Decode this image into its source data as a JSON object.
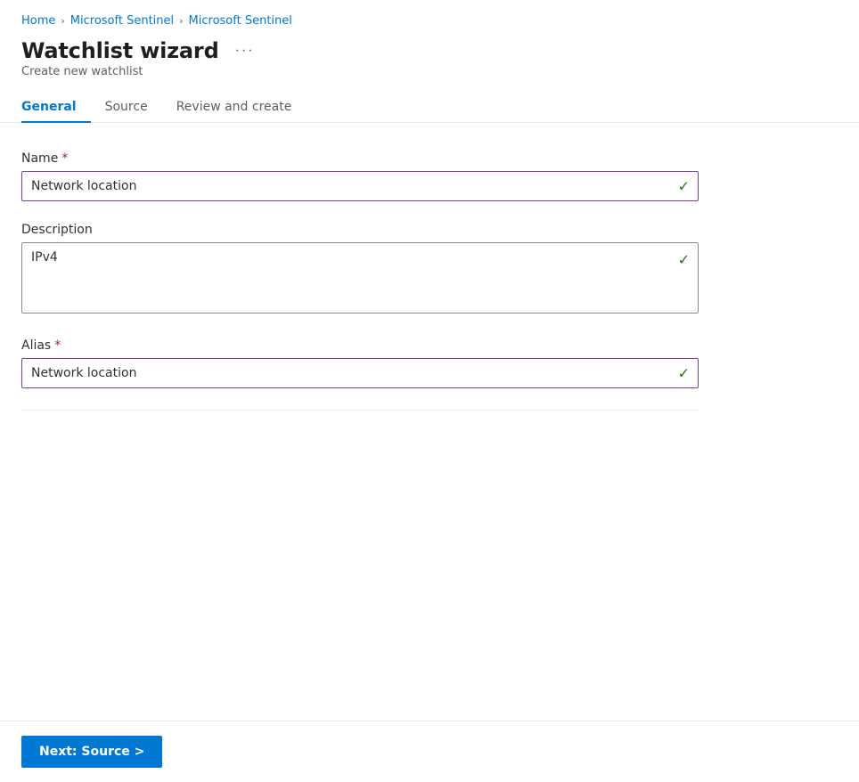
{
  "breadcrumb": {
    "items": [
      {
        "label": "Home",
        "href": "#"
      },
      {
        "label": "Microsoft Sentinel",
        "href": "#"
      },
      {
        "label": "Microsoft Sentinel",
        "href": "#"
      }
    ],
    "separator": "›"
  },
  "header": {
    "title": "Watchlist wizard",
    "more_options_label": "···",
    "subtitle": "Create new watchlist"
  },
  "tabs": [
    {
      "id": "general",
      "label": "General",
      "active": true
    },
    {
      "id": "source",
      "label": "Source",
      "active": false
    },
    {
      "id": "review_create",
      "label": "Review and create",
      "active": false
    }
  ],
  "form": {
    "name_label": "Name",
    "name_required": true,
    "name_value": "Network location",
    "name_check": "✓",
    "description_label": "Description",
    "description_value": "IPv4",
    "description_check": "✓",
    "alias_label": "Alias",
    "alias_required": true,
    "alias_value": "Network location",
    "alias_check": "✓"
  },
  "footer": {
    "next_button_label": "Next: Source >"
  }
}
